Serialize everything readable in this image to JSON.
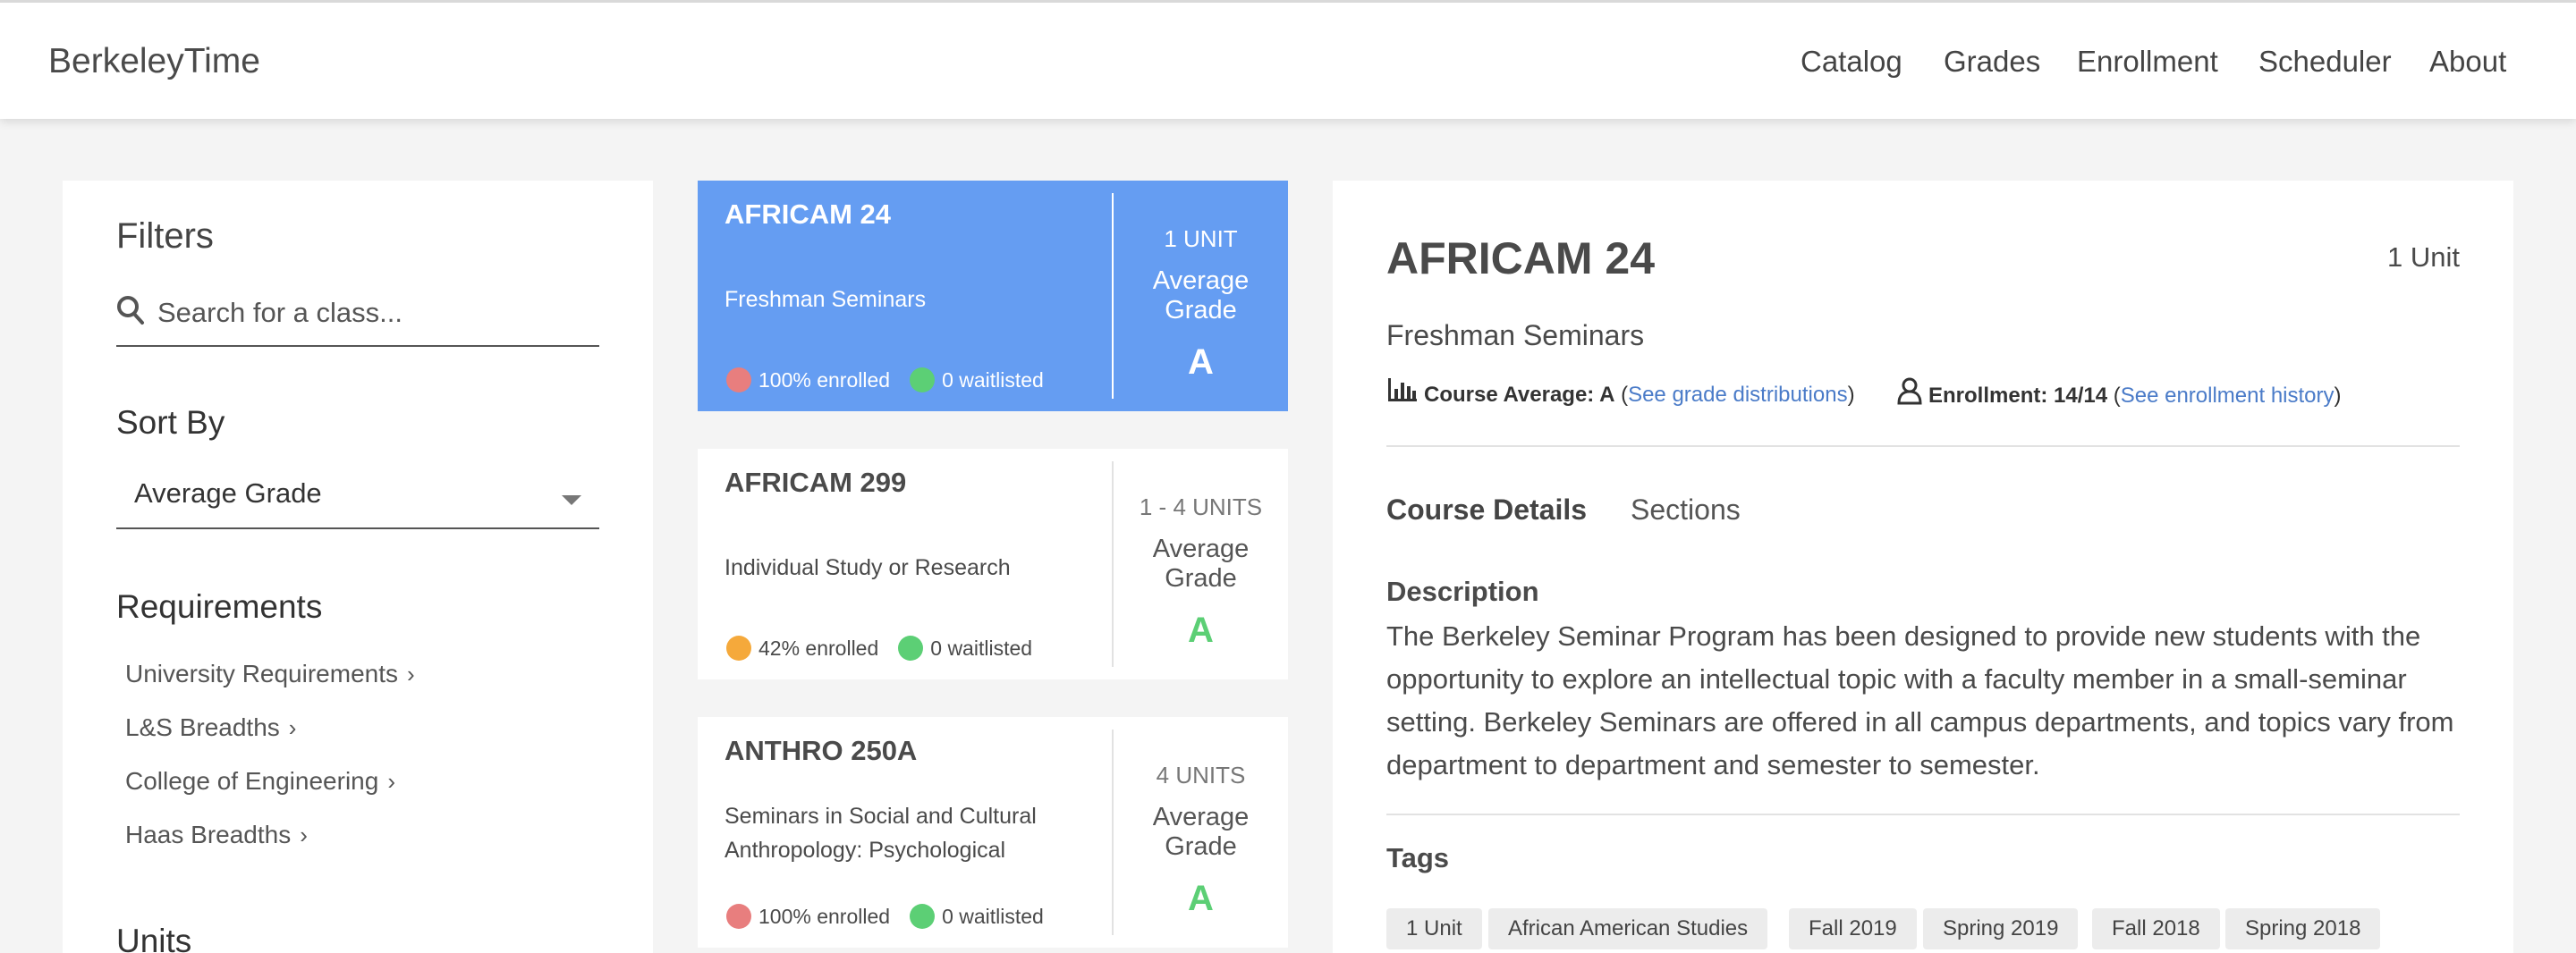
{
  "app": {
    "brand": "BerkeleyTime"
  },
  "nav": {
    "items": [
      "Catalog",
      "Grades",
      "Enrollment",
      "Scheduler",
      "About"
    ]
  },
  "filters": {
    "title": "Filters",
    "search_placeholder": "Search for a class...",
    "sort_title": "Sort By",
    "sort_value": "Average Grade",
    "requirements_title": "Requirements",
    "requirements": [
      "University Requirements",
      "L&S Breadths",
      "College of Engineering",
      "Haas Breadths"
    ],
    "units_title": "Units"
  },
  "courses": [
    {
      "code": "AFRICAM 24",
      "title": "Freshman Seminars",
      "enrolled": "100% enrolled",
      "enrolled_color": "#e87e7e",
      "waitlisted": "0 waitlisted",
      "waitlisted_color": "#5ccf75",
      "units": "1 UNIT",
      "avg_label": "Average Grade",
      "grade": "A",
      "selected": true
    },
    {
      "code": "AFRICAM 299",
      "title": "Individual Study or Research",
      "enrolled": "42% enrolled",
      "enrolled_color": "#f5a93b",
      "waitlisted": "0 waitlisted",
      "waitlisted_color": "#5ccf75",
      "units": "1 - 4 UNITS",
      "avg_label": "Average Grade",
      "grade": "A",
      "selected": false
    },
    {
      "code": "ANTHRO 250A",
      "title": "Seminars in Social and Cultural Anthropology: Psychological",
      "enrolled": "100% enrolled",
      "enrolled_color": "#e87e7e",
      "waitlisted": "0 waitlisted",
      "waitlisted_color": "#5ccf75",
      "units": "4 UNITS",
      "avg_label": "Average Grade",
      "grade": "A",
      "selected": false
    }
  ],
  "detail": {
    "code": "AFRICAM 24",
    "units": "1 Unit",
    "title": "Freshman Seminars",
    "course_average_label": "Course Average: A",
    "grade_link": "See grade distributions",
    "enrollment_label": "Enrollment: 14/14",
    "enrollment_link": "See enrollment history",
    "tabs": [
      "Course Details",
      "Sections"
    ],
    "description_title": "Description",
    "description": "The Berkeley Seminar Program has been designed to provide new students with the opportunity to explore an intellectual topic with a faculty member in a small-seminar setting. Berkeley Seminars are offered in all campus departments, and topics vary from department to department and semester to semester.",
    "tags_title": "Tags",
    "tags": [
      "1 Unit",
      "African American Studies",
      "Fall 2019",
      "Spring 2019",
      "Fall 2018",
      "Spring 2018"
    ]
  },
  "colors": {
    "selected_card": "#659df2",
    "grade_green": "#5ccf75",
    "link_blue": "#4a7bc8"
  },
  "icons": {
    "search": "search-icon",
    "chart": "bar-chart-icon",
    "person": "person-icon",
    "chevron": "chevron-right-icon",
    "caret": "caret-down-icon"
  }
}
